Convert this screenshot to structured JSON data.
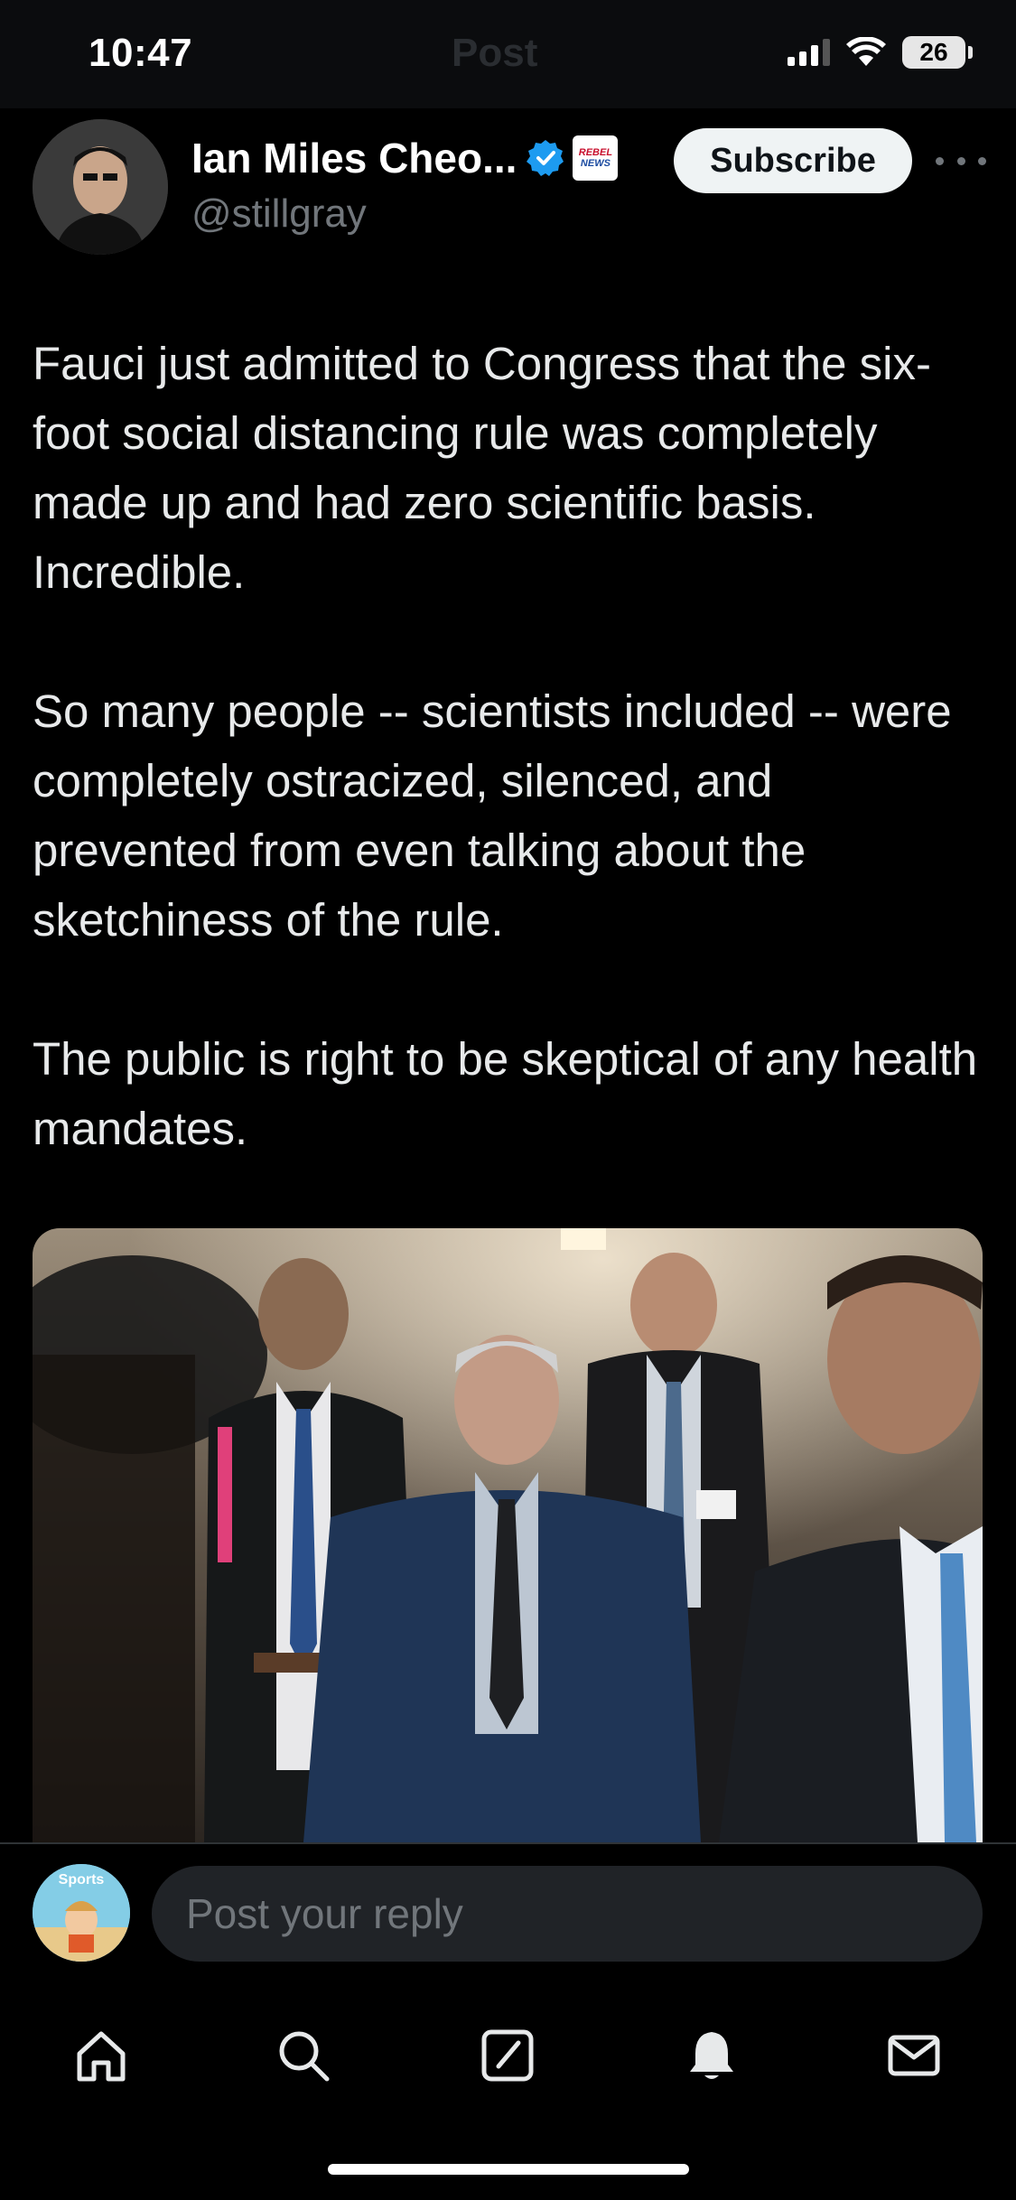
{
  "status_bar": {
    "time": "10:47",
    "battery": "26",
    "faded_nav_title": "Post"
  },
  "post": {
    "author": {
      "name": "Ian Miles Cheo...",
      "handle": "@stillgray",
      "verified": true,
      "affiliate_badge": "REBEL NEWS"
    },
    "subscribe_label": "Subscribe",
    "paragraphs": [
      "Fauci just admitted to Congress that the six-foot social distancing rule was completely made up and had zero scientific basis. Incredible.",
      "So many people -- scientists included -- were completely ostracized, silenced, and prevented from even talking about the sketchiness of the rule.",
      "The public is right to be skeptical of any health mandates."
    ]
  },
  "reply": {
    "placeholder": "Post your reply",
    "avatar_label": "Sports Illustrated"
  },
  "tabbar": {
    "items": [
      "home-icon",
      "search-icon",
      "grok-icon",
      "notifications-icon",
      "messages-icon"
    ]
  },
  "colors": {
    "background": "#000000",
    "text": "#e7e9ea",
    "secondary": "#71767b",
    "verified": "#1d9bf0",
    "input_bg": "#202327"
  }
}
